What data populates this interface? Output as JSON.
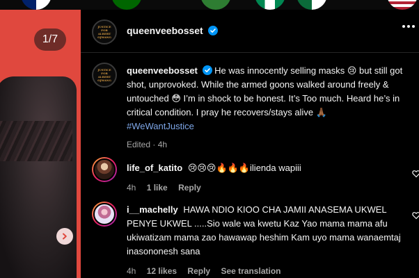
{
  "media": {
    "slide_counter": "1/7",
    "background_color": "#e0483e"
  },
  "post": {
    "username": "queenveebosset",
    "avatar_lines": [
      "JUSTICE",
      "FOR",
      "ALBERT",
      "OJWANG"
    ],
    "caption_text": "He was innocently selling masks 😢 but still got shot, unprovoked. While the armed goons walked around freely & untouched 😳 I’m in shock to be honest. It’s Too much. Heard he’s in critical condition. I pray he recovers/stays alive 🙏🏾",
    "hashtag": "#WeWantJustice",
    "edited_label": "Edited",
    "edited_time": "4h"
  },
  "comments": [
    {
      "username": "life_of_katito",
      "text": "😢😢😢🔥🔥🔥ilienda wapiii",
      "time": "4h",
      "likes": "1 like",
      "reply_label": "Reply"
    },
    {
      "username": "i__machelly",
      "text": "HAWA NDIO KIOO CHA JAMII ANASEMA UKWEL PENYE UKWEL .....Sio wale wa kwetu Kaz Yao mama mama afu ukiwatizam mama zao hawawap heshim Kam uyo mama wanaemtaj inasononesh sana",
      "time": "4h",
      "likes": "12 likes",
      "reply_label": "Reply",
      "translate_label": "See translation"
    }
  ],
  "colors": {
    "accent_verified": "#0095f6",
    "hashtag": "#7ea7e8",
    "meta_text": "#a8a8a8"
  }
}
